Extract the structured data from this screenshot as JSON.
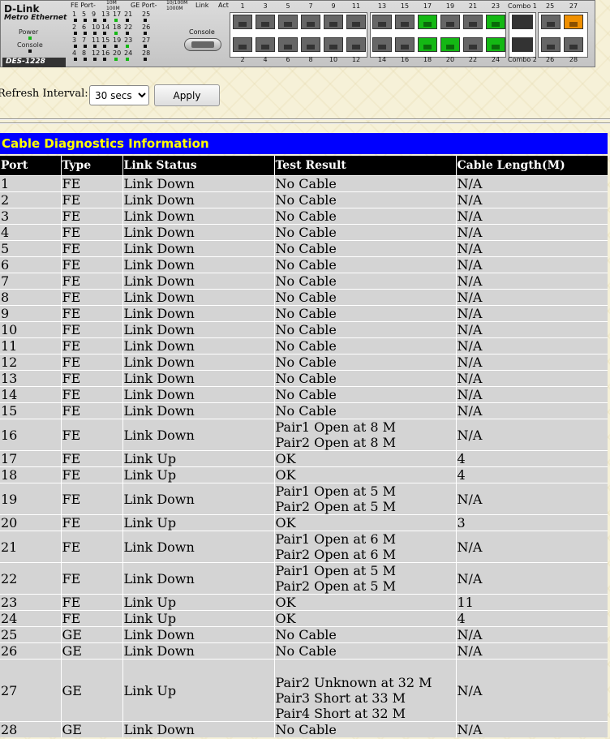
{
  "device": {
    "brand": "D-Link",
    "subbrand": "Metro Ethernet",
    "model": "DES-1228",
    "power_label": "Power",
    "console_label": "Console",
    "legend": {
      "fe_port": "FE Port-",
      "fe_10m": "10M",
      "fe_100m": "100M",
      "ge_port": "GE Port-",
      "ge_10_100m": "10/100M",
      "ge_1000m": "1000M",
      "link": "Link",
      "act": "Act"
    },
    "console_port_label": "Console",
    "combo1_label": "Combo 1",
    "combo2_label": "Combo 2",
    "combo1_port_num": "25",
    "combo2_port_num": "26",
    "led_rows": [
      [
        "1",
        "5",
        "9",
        "13",
        "17",
        "21",
        "25"
      ],
      [
        "2",
        "6",
        "10",
        "14",
        "18",
        "22",
        "26"
      ],
      [
        "3",
        "7",
        "11",
        "15",
        "19",
        "23",
        "27"
      ],
      [
        "4",
        "8",
        "12",
        "16",
        "20",
        "24",
        "28"
      ]
    ],
    "top_port_numbers": [
      "1",
      "3",
      "5",
      "7",
      "9",
      "11",
      "13",
      "15",
      "17",
      "19",
      "21",
      "23",
      "27"
    ],
    "bottom_port_numbers": [
      "2",
      "4",
      "6",
      "8",
      "10",
      "12",
      "14",
      "16",
      "18",
      "20",
      "22",
      "24",
      "28"
    ],
    "link_up_ports": [
      17,
      18,
      20,
      23,
      24
    ],
    "amber_ports": [
      27
    ],
    "colors": {
      "link_up": "#14b814",
      "amber": "#f09000",
      "title_bar": "#0000ff",
      "title_text": "#ffff00"
    }
  },
  "controls": {
    "refresh_label": "Refresh Interval:",
    "refresh_value": "30 secs",
    "apply_label": "Apply"
  },
  "section_title": "Cable Diagnostics Information",
  "table": {
    "headers": [
      "Port",
      "Type",
      "Link Status",
      "Test Result",
      "Cable Length(M)"
    ],
    "rows": [
      [
        "1",
        "FE",
        "Link Down",
        "No Cable",
        "N/A"
      ],
      [
        "2",
        "FE",
        "Link Down",
        "No Cable",
        "N/A"
      ],
      [
        "3",
        "FE",
        "Link Down",
        "No Cable",
        "N/A"
      ],
      [
        "4",
        "FE",
        "Link Down",
        "No Cable",
        "N/A"
      ],
      [
        "5",
        "FE",
        "Link Down",
        "No Cable",
        "N/A"
      ],
      [
        "6",
        "FE",
        "Link Down",
        "No Cable",
        "N/A"
      ],
      [
        "7",
        "FE",
        "Link Down",
        "No Cable",
        "N/A"
      ],
      [
        "8",
        "FE",
        "Link Down",
        "No Cable",
        "N/A"
      ],
      [
        "9",
        "FE",
        "Link Down",
        "No Cable",
        "N/A"
      ],
      [
        "10",
        "FE",
        "Link Down",
        "No Cable",
        "N/A"
      ],
      [
        "11",
        "FE",
        "Link Down",
        "No Cable",
        "N/A"
      ],
      [
        "12",
        "FE",
        "Link Down",
        "No Cable",
        "N/A"
      ],
      [
        "13",
        "FE",
        "Link Down",
        "No Cable",
        "N/A"
      ],
      [
        "14",
        "FE",
        "Link Down",
        "No Cable",
        "N/A"
      ],
      [
        "15",
        "FE",
        "Link Down",
        "No Cable",
        "N/A"
      ],
      [
        "16",
        "FE",
        "Link Down",
        "Pair1 Open at 8 M\nPair2 Open at 8 M",
        "N/A"
      ],
      [
        "17",
        "FE",
        "Link Up",
        "OK",
        "4"
      ],
      [
        "18",
        "FE",
        "Link Up",
        "OK",
        "4"
      ],
      [
        "19",
        "FE",
        "Link Down",
        "Pair1 Open at 5 M\nPair2 Open at 5 M",
        "N/A"
      ],
      [
        "20",
        "FE",
        "Link Up",
        "OK",
        "3"
      ],
      [
        "21",
        "FE",
        "Link Down",
        "Pair1 Open at 6 M\nPair2 Open at 6 M",
        "N/A"
      ],
      [
        "22",
        "FE",
        "Link Down",
        "Pair1 Open at 5 M\nPair2 Open at 5 M",
        "N/A"
      ],
      [
        "23",
        "FE",
        "Link Up",
        "OK",
        "11"
      ],
      [
        "24",
        "FE",
        "Link Up",
        "OK",
        "4"
      ],
      [
        "25",
        "GE",
        "Link Down",
        "No Cable",
        "N/A"
      ],
      [
        "26",
        "GE",
        "Link Down",
        "No Cable",
        "N/A"
      ],
      [
        "27",
        "GE",
        "Link Up",
        "\nPair2 Unknown at 32 M\nPair3 Short at 33 M\nPair4 Short at 32 M",
        "N/A"
      ],
      [
        "28",
        "GE",
        "Link Down",
        "No Cable",
        "N/A"
      ]
    ]
  }
}
